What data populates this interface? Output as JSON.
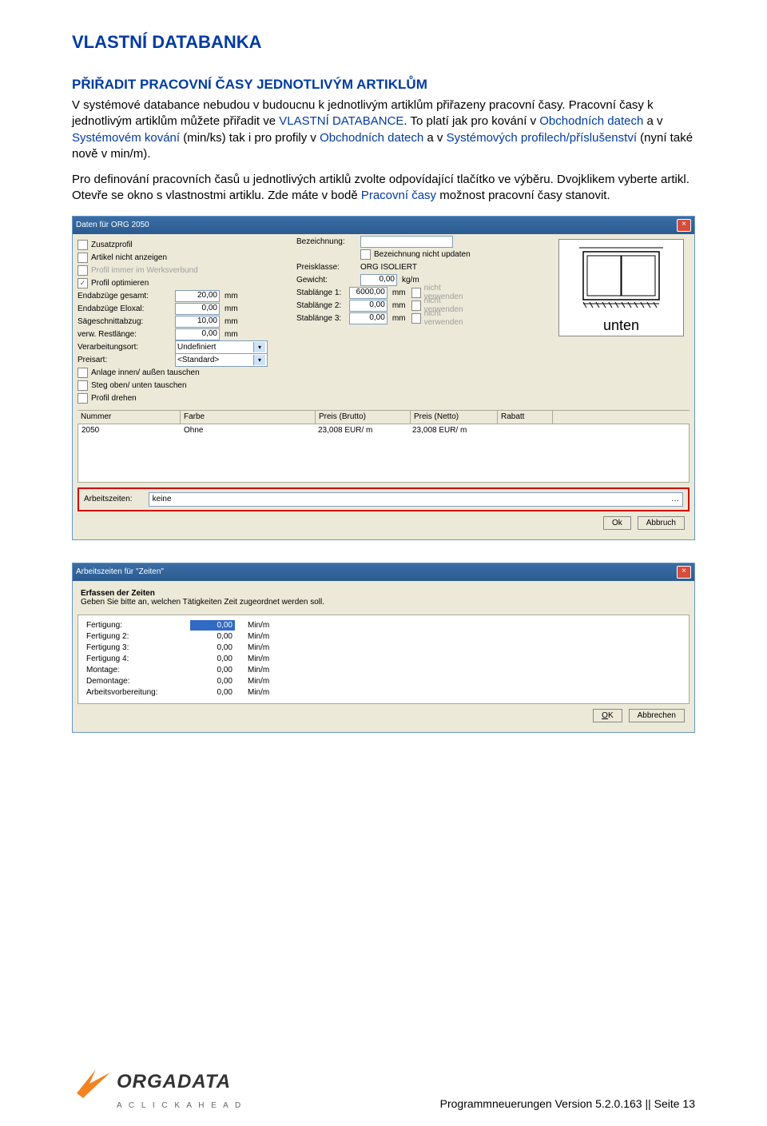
{
  "page": {
    "title": "VLASTNÍ DATABANKA",
    "section_title": "PŘIŘADIT PRACOVNÍ ČASY JEDNOTLIVÝM ARTIKLŮM",
    "para1_a": "V systémové databance nebudou v budoucnu k jednotlivým artiklům přiřazeny pracovní časy. Pracovní časy k jednotlivým artiklům můžete přiřadit ve ",
    "para1_link1": "VLASTNÍ DATABANCE",
    "para1_b": ". To platí jak pro kování v ",
    "para1_link2": "Obchodních datech",
    "para1_c": " a v ",
    "para1_link3": "Systémovém kování",
    "para1_d": " (min/ks) tak i pro profily v ",
    "para1_link4": "Obchodních datech",
    "para1_e": " a v ",
    "para1_link5": "Systémových profilech/příslušenství",
    "para1_f": " (nyní také nově v min/m).",
    "para2_a": "Pro definování pracovních časů u jednotlivých artiklů zvolte odpovídající tlačítko ve výběru. Dvojklikem vyberte artikl. Otevře se okno s vlastnostmi artiklu. Zde máte v bodě ",
    "para2_link": "Pracovní časy",
    "para2_b": " možnost pracovní časy stanovit."
  },
  "win1": {
    "title": "Daten für ORG 2050",
    "checks": {
      "zusatz": "Zusatzprofil",
      "artikel_nicht": "Artikel nicht anzeigen",
      "profil_immer": "Profil immer im Werksverbund",
      "profil_opt": "Profil optimieren",
      "anlage": "Anlage innen/ außen tauschen",
      "steg": "Steg oben/ unten tauschen",
      "profil_drehen": "Profil drehen"
    },
    "labels": {
      "endabzuge": "Endabzüge gesamt:",
      "endabzuge_eloxal": "Endabzüge Eloxal:",
      "sageschnitt": "Sägeschnittabzug:",
      "verw_rest": "verw. Restlänge:",
      "verarbeitung": "Verarbeitungsort:",
      "preisart": "Preisart:"
    },
    "values": {
      "endabzuge": "20,00",
      "endabzuge_eloxal": "0,00",
      "sageschnitt": "10,00",
      "verw_rest": "0,00",
      "verarbeitung": "Undefiniert",
      "preisart": "<Standard>"
    },
    "mid": {
      "bezeichnung": "Bezeichnung:",
      "bez_update": "Bezeichnung nicht updaten",
      "preisklasse_l": "Preisklasse:",
      "preisklasse_v": "ORG ISOLIERT",
      "gewicht_l": "Gewicht:",
      "gewicht_v": "0,00",
      "gewicht_u": "kg/m",
      "stab1_l": "Stablänge 1:",
      "stab1_v": "6000,00",
      "stab2_l": "Stablänge 2:",
      "stab2_v": "0,00",
      "stab3_l": "Stablänge 3:",
      "stab3_v": "0,00",
      "nicht": "nicht verwenden"
    },
    "unten": "unten",
    "table": {
      "h_nummer": "Nummer",
      "h_farbe": "Farbe",
      "h_brutto": "Preis (Brutto)",
      "h_netto": "Preis (Netto)",
      "h_rabatt": "Rabatt",
      "r_nummer": "2050",
      "r_farbe": "Ohne",
      "r_brutto": "23,008 EUR/ m",
      "r_netto": "23,008 EUR/ m"
    },
    "arw_label": "Arbeitszeiten:",
    "arw_value": "keine",
    "ok": "Ok",
    "cancel": "Abbruch"
  },
  "win2": {
    "title": "Arbeitszeiten für \"Zeiten\"",
    "group_head": "Erfassen der Zeiten",
    "group_desc": "Geben Sie bitte an, welchen Tätigkeiten Zeit zugeordnet werden soll.",
    "rows": [
      {
        "l": "Fertigung:",
        "v": "0,00",
        "u": "Min/m",
        "sel": true
      },
      {
        "l": "Fertigung 2:",
        "v": "0,00",
        "u": "Min/m"
      },
      {
        "l": "Fertigung 3:",
        "v": "0,00",
        "u": "Min/m"
      },
      {
        "l": "Fertigung 4:",
        "v": "0,00",
        "u": "Min/m"
      },
      {
        "l": "Montage:",
        "v": "0,00",
        "u": "Min/m"
      },
      {
        "l": "Demontage:",
        "v": "0,00",
        "u": "Min/m"
      },
      {
        "l": "Arbeitsvorbereitung:",
        "v": "0,00",
        "u": "Min/m"
      }
    ],
    "ok": "OK",
    "cancel": "Abbrechen"
  },
  "footer": {
    "brand": "ORGADATA",
    "tagline": "A  C L I C K  A H E A D",
    "pagenum": "Programmneuerungen Version 5.2.0.163 || Seite 13"
  }
}
